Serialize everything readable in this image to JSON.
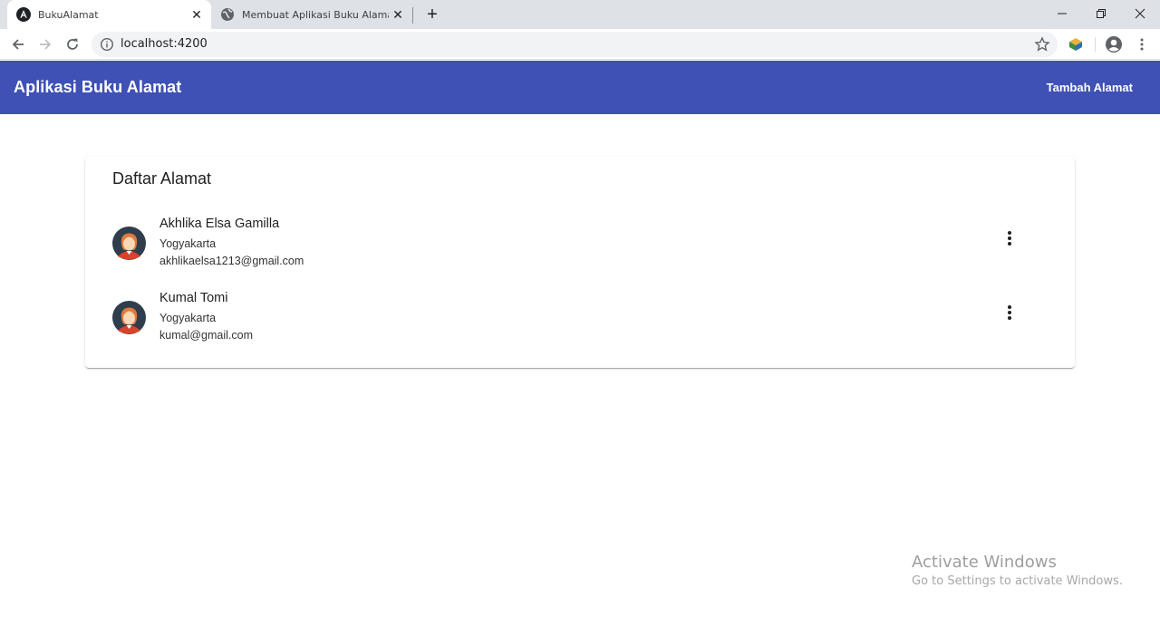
{
  "browser": {
    "tabs": [
      {
        "title": "BukuAlamat",
        "active": true
      },
      {
        "title": "Membuat Aplikasi Buku Alamat M",
        "active": false
      }
    ],
    "address": "localhost:4200"
  },
  "app": {
    "brand": "Aplikasi Buku Alamat",
    "add_label": "Tambah Alamat",
    "accent": "#3f51b5"
  },
  "card": {
    "title": "Daftar Alamat",
    "contacts": [
      {
        "name": "Akhlika Elsa Gamilla",
        "city": "Yogyakarta",
        "email": "akhlikaelsa1213@gmail.com"
      },
      {
        "name": "Kumal Tomi",
        "city": "Yogyakarta",
        "email": "kumal@gmail.com"
      }
    ]
  },
  "watermark": {
    "line1": "Activate Windows",
    "line2": "Go to Settings to activate Windows."
  }
}
